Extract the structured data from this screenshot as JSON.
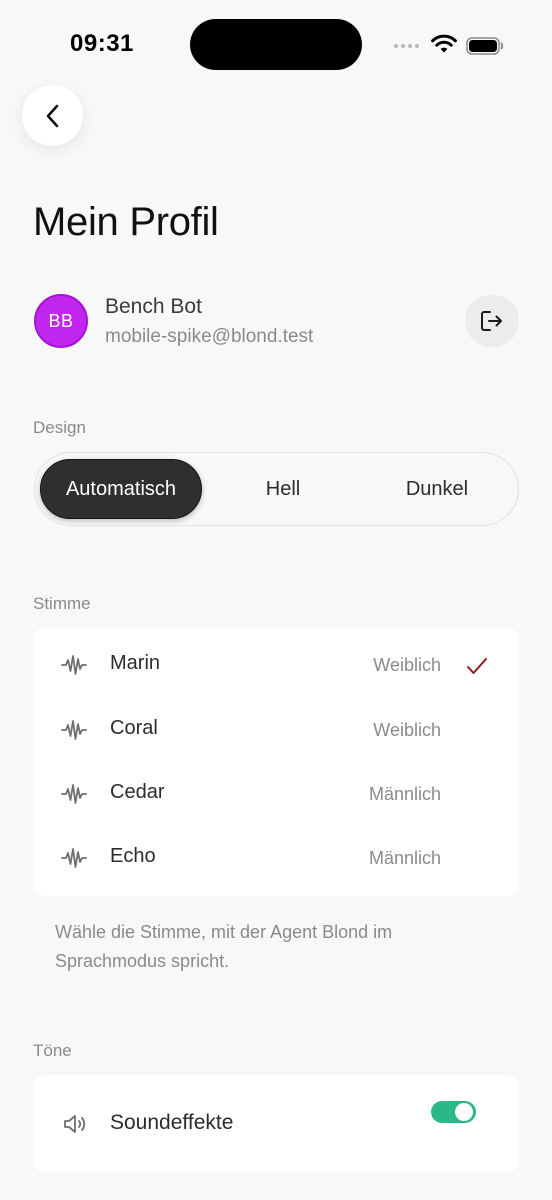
{
  "status_bar": {
    "time": "09:31"
  },
  "page_title": "Mein Profil",
  "profile": {
    "initials": "BB",
    "name": "Bench Bot",
    "email": "mobile-spike@blond.test",
    "avatar_color": "#c026ee"
  },
  "design": {
    "label": "Design",
    "options": [
      "Automatisch",
      "Hell",
      "Dunkel"
    ],
    "selected": "Automatisch"
  },
  "voice": {
    "label": "Stimme",
    "items": [
      {
        "name": "Marin",
        "gender": "Weiblich",
        "selected": true
      },
      {
        "name": "Coral",
        "gender": "Weiblich",
        "selected": false
      },
      {
        "name": "Cedar",
        "gender": "Männlich",
        "selected": false
      },
      {
        "name": "Echo",
        "gender": "Männlich",
        "selected": false
      }
    ],
    "hint": "Wähle die Stimme, mit der Agent Blond im Sprachmodus spricht.",
    "check_color": "#8b1a1a"
  },
  "tones": {
    "label": "Töne",
    "sound_effects_label": "Soundeffekte",
    "sound_effects_on": true,
    "toggle_color": "#2ab886"
  }
}
